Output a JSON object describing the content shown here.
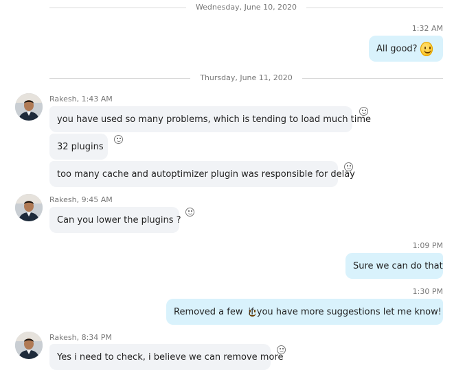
{
  "separators": {
    "wed": "Wednesday, June 10, 2020",
    "thu": "Thursday, June 11, 2020"
  },
  "messages": {
    "m1": {
      "time": "1:32 AM",
      "text": "All good?"
    },
    "g1": {
      "sender": "Rakesh, 1:43 AM",
      "b1": "you have used so many problems, which is tending to load much time",
      "b2": "32 plugins",
      "b3": "too many cache and autoptimizer plugin was responsible for delay"
    },
    "g2": {
      "sender": "Rakesh, 9:45 AM",
      "b1": "Can you lower the plugins ?"
    },
    "m2": {
      "time": "1:09 PM",
      "text": "Sure we can do that"
    },
    "m3": {
      "time": "1:30 PM",
      "text_before": "Removed a few",
      "text_after": "if you have more suggestions let me know!"
    },
    "g3": {
      "sender": "Rakesh, 8:34 PM",
      "b1": "Yes i need to check, i believe we can remove more"
    }
  },
  "icons": {
    "emoji": "slightly-smiling-face-emoji",
    "react": "add-reaction-smiley-icon",
    "avatar": "contact-avatar"
  }
}
